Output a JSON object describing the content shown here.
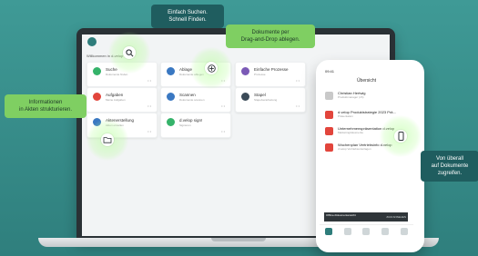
{
  "callouts": {
    "search": "Einfach Suchen.\nSchnell Finden.",
    "dragdrop": "Dokumente per\nDrag-and-Drop ablegen.",
    "structure": "Informationen\nin Akten strukturieren.",
    "mobile": "Von überall\nauf Dokumente\nzugreifen."
  },
  "app": {
    "breadcrumb": "Willkommen in d-velop",
    "tiles": [
      {
        "label": "Suche",
        "sub": "Dokumente finden",
        "color": "#35b36a"
      },
      {
        "label": "Ablage",
        "sub": "Dokumente ablegen",
        "color": "#3a78c2"
      },
      {
        "label": "Einfache Prozesse",
        "sub": "Prozesse",
        "color": "#7b5ab6"
      },
      {
        "label": "Aufgaben",
        "sub": "Meine Aufgaben",
        "color": "#e2453c"
      },
      {
        "label": "Scannen",
        "sub": "Dokumente scannen",
        "color": "#3a78c2"
      },
      {
        "label": "Stapel",
        "sub": "Stapelverarbeitung",
        "color": "#3b4a57"
      },
      {
        "label": "Aktenerstellung",
        "sub": "Akten erstellen",
        "color": "#3a78c2"
      },
      {
        "label": "d.velop sign!",
        "sub": "Signieren",
        "color": "#35b36a"
      }
    ]
  },
  "phone": {
    "status": "09:41",
    "title": "Übersicht",
    "items": [
      {
        "name": "Christian Hertwig",
        "meta": "Produktmanager (vS)"
      },
      {
        "name": "d.velop Produktstrategie 2023 Prä…",
        "meta": "Präsentation"
      },
      {
        "name": "Unternehmenspräsentation d.velop",
        "meta": "Marketingdokumente"
      },
      {
        "name": "Wochenplan Vertriebsinfo d.velop",
        "meta": "d.velop Vertriebsunterlagen"
      }
    ],
    "toast_left": "Offline-Dokumentansicht",
    "toast_right": "ZUM ANSEHEN"
  }
}
